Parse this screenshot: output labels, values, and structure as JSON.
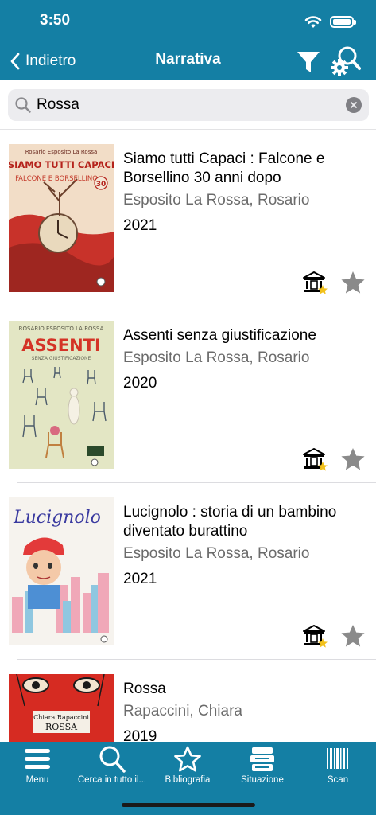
{
  "status_bar": {
    "time": "3:50"
  },
  "nav": {
    "back_label": "Indietro",
    "title": "Narrativa"
  },
  "search": {
    "value": "Rossa",
    "placeholder": ""
  },
  "results": [
    {
      "title": "Siamo tutti Capaci : Falcone e Borsellino 30 anni dopo",
      "author": "Esposito La Rossa, Rosario",
      "year": "2021"
    },
    {
      "title": "Assenti senza giustificazione",
      "author": "Esposito La Rossa, Rosario",
      "year": "2020"
    },
    {
      "title": "Lucignolo : storia di un bambino diventato burattino",
      "author": "Esposito La Rossa, Rosario",
      "year": "2021"
    },
    {
      "title": "Rossa",
      "author": "Rapaccini, Chiara",
      "year": "2019"
    }
  ],
  "covers": {
    "c1": {
      "top": "Rosario Esposito La Rossa",
      "headline": "SIAMO TUTTI CAPACI",
      "sub": "FALCONE E BORSELLINO",
      "badge": "30"
    },
    "c2": {
      "top": "ROSARIO ESPOSITO LA ROSSA",
      "headline": "ASSENTI",
      "sub": "SENZA GIUSTIFICAZIONE"
    },
    "c3": {
      "script": "Lucignolo"
    },
    "c4": {
      "author": "Chiara Rapaccini",
      "title": "ROSSA"
    }
  },
  "tabs": [
    {
      "label": "Menu",
      "icon": "menu-icon"
    },
    {
      "label": "Cerca in tutto il...",
      "icon": "search-icon"
    },
    {
      "label": "Bibliografia",
      "icon": "star-icon"
    },
    {
      "label": "Situazione",
      "icon": "stack-icon"
    },
    {
      "label": "Scan",
      "icon": "barcode-icon"
    }
  ],
  "colors": {
    "brand": "#147fa4",
    "star_badge": "#f2c11b",
    "icon_gray": "#8a8a8a"
  }
}
